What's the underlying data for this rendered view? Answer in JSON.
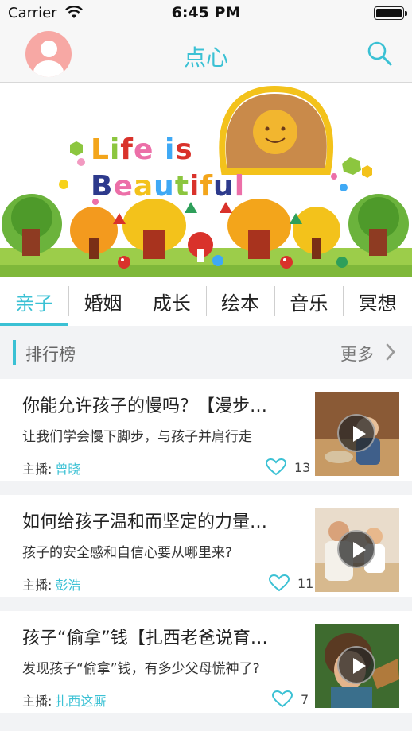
{
  "status_bar": {
    "carrier": "Carrier",
    "time": "6:45 PM"
  },
  "nav": {
    "title": "点心"
  },
  "banner": {
    "text_line1": [
      "L",
      "i",
      "f",
      "e",
      " ",
      "i",
      "s"
    ],
    "text_line2": [
      "B",
      "e",
      "a",
      "u",
      "t",
      "i",
      "f",
      "u",
      "l"
    ]
  },
  "tabs": [
    {
      "label": "亲子",
      "active": true
    },
    {
      "label": "婚姻",
      "active": false
    },
    {
      "label": "成长",
      "active": false
    },
    {
      "label": "绘本",
      "active": false
    },
    {
      "label": "音乐",
      "active": false
    },
    {
      "label": "冥想",
      "active": false
    }
  ],
  "section": {
    "title": "排行榜",
    "more": "更多"
  },
  "host_label": "主播:",
  "cards": [
    {
      "title": "你能允许孩子的慢吗？【漫步…",
      "subtitle": "让我们学会慢下脚步，与孩子并肩行走",
      "host": "曾晓",
      "likes": "13"
    },
    {
      "title": "如何给孩子温和而坚定的力量…",
      "subtitle": "孩子的安全感和自信心要从哪里来?",
      "host": "彭浩",
      "likes": "11"
    },
    {
      "title": "孩子“偷拿”钱【扎西老爸说育…",
      "subtitle": "发现孩子“偷拿”钱，有多少父母慌神了?",
      "host": "扎西这厮",
      "likes": "7"
    }
  ],
  "colors": {
    "accent": "#3bc1d4",
    "avatar": "#f7a8a4"
  }
}
